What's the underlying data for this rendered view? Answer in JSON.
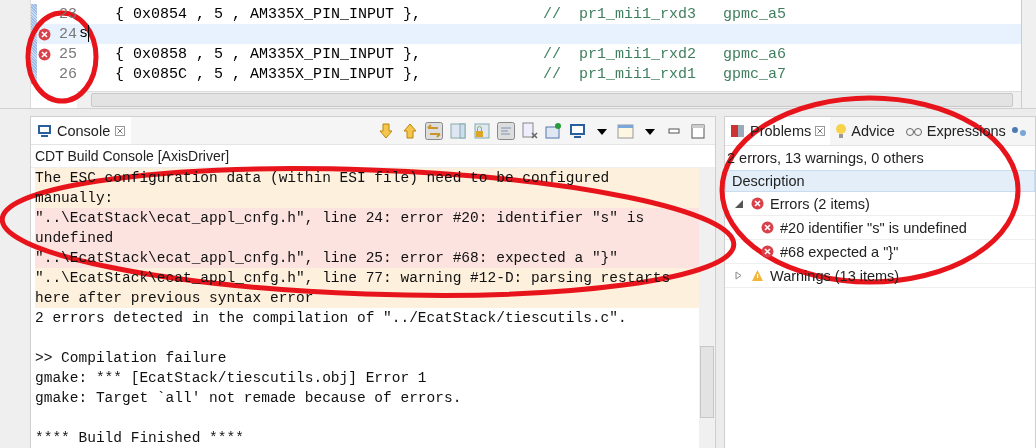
{
  "editor": {
    "lines": [
      {
        "number": "23",
        "error": false,
        "current": false,
        "code": "    { 0x0854 , 5 , AM335X_PIN_INPUT },",
        "comment": "//  pr1_mii1_rxd3   gpmc_a5"
      },
      {
        "number": "24",
        "error": true,
        "current": true,
        "code": "s"
      },
      {
        "number": "25",
        "error": true,
        "current": false,
        "code": "    { 0x0858 , 5 , AM335X_PIN_INPUT },",
        "comment": "//  pr1_mii1_rxd2   gpmc_a6"
      },
      {
        "number": "26",
        "error": false,
        "current": false,
        "code": "    { 0x085C , 5 , AM335X_PIN_INPUT },",
        "comment": "//  pr1_mii1_rxd1   gpmc_a7"
      }
    ]
  },
  "console": {
    "tab": {
      "label": "Console",
      "selected": true
    },
    "title": "CDT Build Console [AxisDriver]",
    "lines": [
      {
        "kind": "info",
        "text": "The ESC configuration data (within ESI file) need to be configured"
      },
      {
        "kind": "info",
        "text": "manually:"
      },
      {
        "kind": "error",
        "text": "\"..\\EcatStack\\ecat_appl_cnfg.h\", line 24: error #20: identifier \"s\" is"
      },
      {
        "kind": "error",
        "text": "undefined"
      },
      {
        "kind": "error",
        "text": "\"..\\EcatStack\\ecat_appl_cnfg.h\", line 25: error #68: expected a \"}\""
      },
      {
        "kind": "warning",
        "text": "\"..\\EcatStack\\ecat_appl_cnfg.h\", line 77: warning #12-D: parsing restarts"
      },
      {
        "kind": "warning",
        "text": "here after previous syntax error"
      },
      {
        "kind": "plain",
        "text": "2 errors detected in the compilation of \"../EcatStack/tiescutils.c\"."
      },
      {
        "kind": "blank"
      },
      {
        "kind": "plain",
        "text": ">> Compilation failure"
      },
      {
        "kind": "plain",
        "text": "gmake: *** [EcatStack/tiescutils.obj] Error 1"
      },
      {
        "kind": "plain",
        "text": "gmake: Target `all' not remade because of errors."
      },
      {
        "kind": "blank"
      },
      {
        "kind": "plain",
        "text": "**** Build Finished ****"
      }
    ]
  },
  "problems": {
    "tabs": [
      {
        "label": "Problems",
        "selected": true,
        "kind": "problems"
      },
      {
        "label": "Advice",
        "selected": false,
        "kind": "advice"
      },
      {
        "label": "Expressions",
        "selected": false,
        "kind": "expressions"
      }
    ],
    "summary": "2 errors, 13 warnings, 0 others",
    "column": "Description",
    "tree": [
      {
        "label": "Errors (2 items)",
        "kind": "error",
        "expanded": true,
        "children": [
          {
            "label": "#20 identifier \"s\" is undefined",
            "kind": "error"
          },
          {
            "label": "#68 expected a \"}\"",
            "kind": "error"
          }
        ]
      },
      {
        "label": "Warnings (13 items)",
        "kind": "warning",
        "expanded": false
      }
    ]
  }
}
